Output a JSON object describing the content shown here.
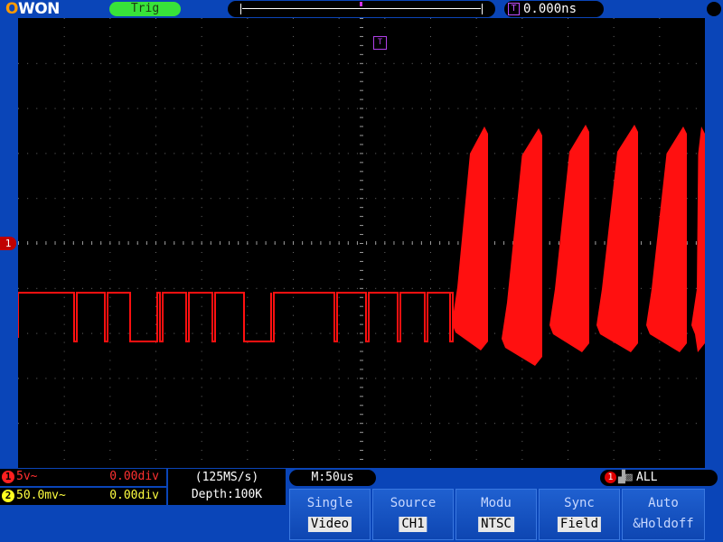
{
  "header": {
    "logo": "OWON",
    "trig_status": "Trig",
    "trigger_pos_label": "T",
    "time_offset": "0.000ns"
  },
  "screen": {
    "trigger_marker": "T",
    "ch1_marker": "1"
  },
  "channels": [
    {
      "number": "1",
      "volts": "5v~",
      "offset": "0.00div",
      "color": "#ff2020"
    },
    {
      "number": "2",
      "volts": "50.0mv~",
      "offset": "0.00div",
      "color": "#ffff20"
    }
  ],
  "acquisition": {
    "sample_rate": "(125MS/s)",
    "depth": "Depth:100K"
  },
  "timebase": "M:50us",
  "trigger_source": {
    "channel": "1",
    "text": "ALL"
  },
  "menu": [
    {
      "title": "Single",
      "value": "Video"
    },
    {
      "title": "Source",
      "value": "CH1"
    },
    {
      "title": "Modu",
      "value": "NTSC"
    },
    {
      "title": "Sync",
      "value": "Field"
    },
    {
      "title": "Auto",
      "value": "&Holdoff"
    }
  ],
  "colors": {
    "background": "#0a45b8",
    "screen": "#000000",
    "ch1_trace": "#ff1010",
    "trig_ok": "#38e23a",
    "trigger_marker": "#b040e8"
  }
}
